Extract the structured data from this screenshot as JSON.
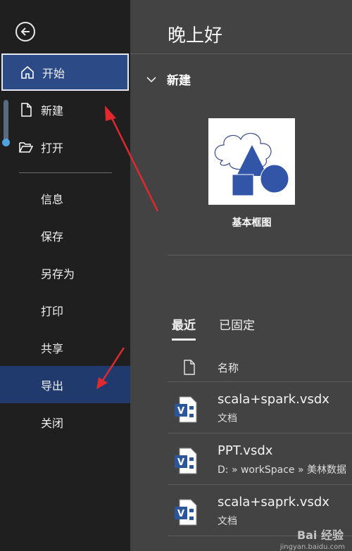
{
  "sidebar": {
    "items": [
      {
        "label": "开始",
        "icon": "home-icon"
      },
      {
        "label": "新建",
        "icon": "new-document-icon"
      },
      {
        "label": "打开",
        "icon": "open-folder-icon"
      },
      {
        "label": "信息"
      },
      {
        "label": "保存"
      },
      {
        "label": "另存为"
      },
      {
        "label": "打印"
      },
      {
        "label": "共享"
      },
      {
        "label": "导出"
      },
      {
        "label": "关闭"
      }
    ]
  },
  "main": {
    "greeting": "晚上好",
    "new_section": "新建",
    "template_label": "基本框图",
    "tabs": [
      "最近",
      "已固定"
    ],
    "column_name": "名称",
    "files": [
      {
        "name": "scala+spark.vsdx",
        "path": "文档"
      },
      {
        "name": "PPT.vsdx",
        "path": "D: » workSpace » 美林数据"
      },
      {
        "name": "scala+saprk.vsdx",
        "path": "文档"
      }
    ]
  },
  "watermark": {
    "text": "Bai 经验",
    "sub": "jingyan.baidu.com"
  },
  "colors": {
    "sidebar": "#1f1f1f",
    "main": "#434343",
    "accent": "#2c4a85",
    "arrow": "#e0282f",
    "visio": "#2b579a"
  }
}
